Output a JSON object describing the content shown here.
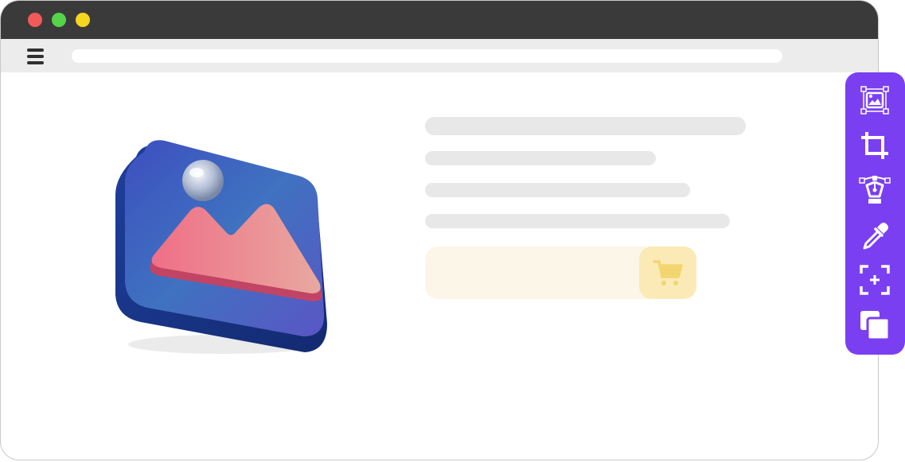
{
  "window": {
    "controls": [
      {
        "name": "close",
        "color": "#f25a5a"
      },
      {
        "name": "minimize",
        "color": "#57d24b"
      },
      {
        "name": "zoom",
        "color": "#f5d51e"
      }
    ]
  },
  "toolbar": {
    "menu_icon": "hamburger-menu-icon",
    "address_value": ""
  },
  "hero": {
    "icon": "image-gallery-icon"
  },
  "content": {
    "cart_icon": "shopping-cart-icon"
  },
  "tools_panel": {
    "accent": "#7b3ff2",
    "items": [
      {
        "name": "image-select-tool",
        "icon": "image-frame-icon"
      },
      {
        "name": "crop-tool",
        "icon": "crop-icon"
      },
      {
        "name": "pen-tool",
        "icon": "bezier-pen-icon"
      },
      {
        "name": "color-picker-tool",
        "icon": "eyedropper-icon"
      },
      {
        "name": "focus-tool",
        "icon": "focus-frame-icon"
      },
      {
        "name": "layers-tool",
        "icon": "layers-icon"
      }
    ]
  }
}
